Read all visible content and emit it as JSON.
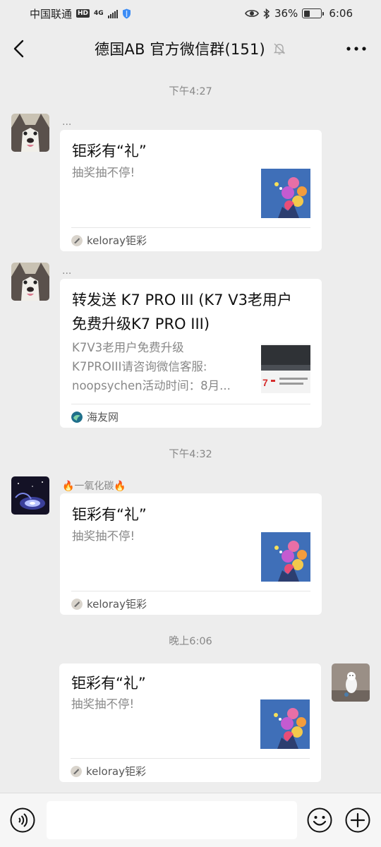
{
  "status_bar": {
    "carrier": "中国联通",
    "hd_badge": "HD",
    "network": "4G",
    "battery_text": "36%",
    "battery_level": 0.36,
    "time": "6:06"
  },
  "header": {
    "title": "德国AB  官方微信群(151)"
  },
  "messages": [
    {
      "timestamp": "下午4:27",
      "sender": "...",
      "card": {
        "title": "钜彩有“礼”",
        "desc": "抽奖抽不停!",
        "source": "keloray钜彩"
      }
    },
    {
      "sender": "...",
      "card": {
        "title_line1": "转发送 K7 PRO III (K7 V3老用户",
        "title_line2": "免费升级K7 PRO III)",
        "desc_line1": "K7V3老用户免费升级",
        "desc_line2": "K7PROIII请咨询微信客服:",
        "desc_line3": "noopsychen活动时间：8月...",
        "thumb_text": "7",
        "source": "海友网"
      }
    },
    {
      "timestamp": "下午4:32",
      "sender": "🔥一氧化碳🔥",
      "card": {
        "title": "钜彩有“礼”",
        "desc": "抽奖抽不停!",
        "source": "keloray钜彩"
      }
    },
    {
      "timestamp": "晚上6:06",
      "card": {
        "title": "钜彩有“礼”",
        "desc": "抽奖抽不停!",
        "source": "keloray钜彩"
      }
    }
  ],
  "input_bar": {
    "value": "",
    "placeholder": ""
  },
  "colors": {
    "background": "#ededed",
    "card": "#ffffff",
    "timestamp_text": "#888888"
  }
}
